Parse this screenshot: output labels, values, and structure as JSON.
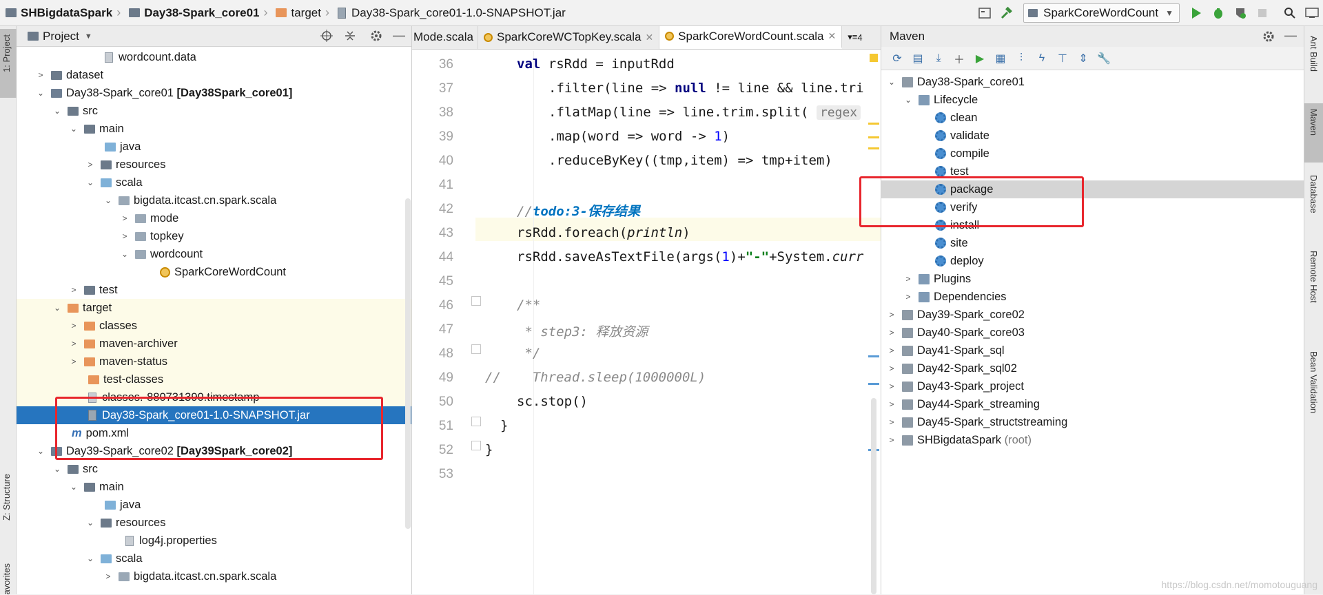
{
  "navbar": {
    "crumbs": [
      {
        "label": "SHBigdataSpark",
        "bold": true
      },
      {
        "label": "Day38-Spark_core01",
        "bold": true
      },
      {
        "label": "target",
        "bold": false
      },
      {
        "label": "Day38-Spark_core01-1.0-SNAPSHOT.jar",
        "bold": false
      }
    ],
    "run_config": "SparkCoreWordCount"
  },
  "left_stripe": {
    "tab_project": "1: Project",
    "tab_structure": "Z: Structure",
    "tab_favorites": "avorites"
  },
  "project": {
    "title": "Project",
    "rows": [
      {
        "label": "wordcount.data",
        "suffix": ""
      },
      {
        "label": "dataset",
        "suffix": ""
      },
      {
        "label": "Day38-Spark_core01",
        "suffix": "[Day38Spark_core01]"
      },
      {
        "label": "src",
        "suffix": ""
      },
      {
        "label": "main",
        "suffix": ""
      },
      {
        "label": "java",
        "suffix": ""
      },
      {
        "label": "resources",
        "suffix": ""
      },
      {
        "label": "scala",
        "suffix": ""
      },
      {
        "label": "bigdata.itcast.cn.spark.scala",
        "suffix": ""
      },
      {
        "label": "mode",
        "suffix": ""
      },
      {
        "label": "topkey",
        "suffix": ""
      },
      {
        "label": "wordcount",
        "suffix": ""
      },
      {
        "label": "SparkCoreWordCount",
        "suffix": ""
      },
      {
        "label": "test",
        "suffix": ""
      },
      {
        "label": "target",
        "suffix": ""
      },
      {
        "label": "classes",
        "suffix": ""
      },
      {
        "label": "maven-archiver",
        "suffix": ""
      },
      {
        "label": "maven-status",
        "suffix": ""
      },
      {
        "label": "test-classes",
        "suffix": ""
      },
      {
        "label": "classes.-880731390.timestamp",
        "suffix": ""
      },
      {
        "label": "Day38-Spark_core01-1.0-SNAPSHOT.jar",
        "suffix": ""
      },
      {
        "label": "pom.xml",
        "suffix": ""
      },
      {
        "label": "Day39-Spark_core02",
        "suffix": "[Day39Spark_core02]"
      },
      {
        "label": "src",
        "suffix": ""
      },
      {
        "label": "main",
        "suffix": ""
      },
      {
        "label": "java",
        "suffix": ""
      },
      {
        "label": "resources",
        "suffix": ""
      },
      {
        "label": "log4j.properties",
        "suffix": ""
      },
      {
        "label": "scala",
        "suffix": ""
      },
      {
        "label": "bigdata.itcast.cn.spark.scala",
        "suffix": ""
      }
    ]
  },
  "editor": {
    "tabs": [
      "Mode.scala",
      "SparkCoreWCTopKey.scala",
      "SparkCoreWordCount.scala"
    ],
    "tab_overflow": "4",
    "line_numbers": [
      "36",
      "37",
      "38",
      "39",
      "40",
      "41",
      "42",
      "43",
      "44",
      "45",
      "46",
      "47",
      "48",
      "49",
      "50",
      "51",
      "52",
      "53"
    ],
    "lines": {
      "l36_kw": "val",
      "l36": " rsRdd = inputRdd",
      "l37a": ".filter(line => ",
      "l37_kw": "null",
      "l37b": " != line && line.tri",
      "l38": ".flatMap(line => line.trim.split( ",
      "l38_hint": "regex",
      "l39a": ".map(word => word -> ",
      "l39_num": "1",
      "l39b": ")",
      "l40": ".reduceByKey((tmp,item) => tmp+item)",
      "l42_cm": "//",
      "l42_todo": "todo:3-保存结果",
      "l43a": "rsRdd.foreach(",
      "l43_fn": "println",
      "l43b": ")",
      "l44a": "rsRdd.saveAsTextFile(args(",
      "l44_num": "1",
      "l44b": ")+",
      "l44_str": "\"-\"",
      "l44c": "+System.",
      "l44_fn": "curr",
      "l46": "/**",
      "l47": " * step3: 释放资源",
      "l48": " */",
      "l49_cm": "//",
      "l49": "    Thread.sleep(1000000L)",
      "l50": "sc.stop()",
      "l51": "}",
      "l52": "}"
    }
  },
  "maven": {
    "title": "Maven",
    "rows": [
      {
        "label": "Day38-Spark_core01"
      },
      {
        "label": "Lifecycle"
      },
      {
        "label": "clean"
      },
      {
        "label": "validate"
      },
      {
        "label": "compile"
      },
      {
        "label": "test"
      },
      {
        "label": "package"
      },
      {
        "label": "verify"
      },
      {
        "label": "install"
      },
      {
        "label": "site"
      },
      {
        "label": "deploy"
      },
      {
        "label": "Plugins"
      },
      {
        "label": "Dependencies"
      },
      {
        "label": "Day39-Spark_core02"
      },
      {
        "label": "Day40-Spark_core03"
      },
      {
        "label": "Day41-Spark_sql"
      },
      {
        "label": "Day42-Spark_sql02"
      },
      {
        "label": "Day43-Spark_project"
      },
      {
        "label": "Day44-Spark_streaming"
      },
      {
        "label": "Day45-Spark_structstreaming"
      },
      {
        "label": "SHBigdataSpark"
      }
    ],
    "root_suffix": "(root)"
  },
  "right_stripe": [
    "Ant Build",
    "Maven",
    "Database",
    "Remote Host",
    "Bean Validation"
  ],
  "watermark": "https://blog.csdn.net/momotouguang",
  "colors": {
    "selection": "#2675bf",
    "annotation_red": "#e8262d",
    "highlight_yellow": "#fdfbe8"
  }
}
